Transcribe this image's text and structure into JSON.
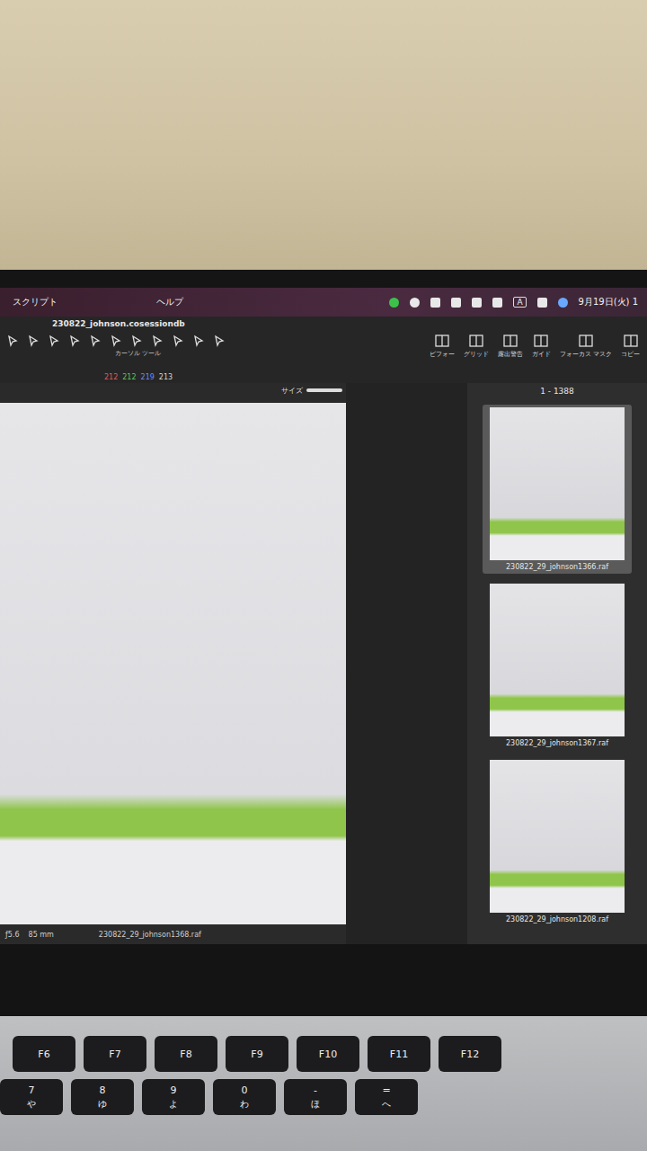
{
  "menubar": {
    "items": [
      {
        "label": "スクリプト"
      },
      {
        "label": "ヘルプ"
      }
    ],
    "input_source": "A",
    "clock": "9月19日(火) 1"
  },
  "document": {
    "title": "230822_johnson.cosessiondb"
  },
  "tools": {
    "label": "カーソル ツール"
  },
  "toolbar_buttons": [
    {
      "label": "ビフォー"
    },
    {
      "label": "グリッド"
    },
    {
      "label": "露出警告"
    },
    {
      "label": "ガイド"
    },
    {
      "label": "フォーカス マスク"
    },
    {
      "label": "コピー"
    }
  ],
  "readout": [
    {
      "value": "212",
      "color": "#e05a5a"
    },
    {
      "value": "212",
      "color": "#5ec45e"
    },
    {
      "value": "219",
      "color": "#6a8cff"
    },
    {
      "value": "213",
      "color": "#d8d8d8"
    }
  ],
  "viewer": {
    "size_label": "サイズ",
    "caption": "230822_29_johnson1368.raf",
    "aperture": "ƒ5.6",
    "focal": "85 mm"
  },
  "browser": {
    "range": "1 - 1388",
    "thumbnails": [
      {
        "filename": "230822_29_johnson1366.raf",
        "selected": true
      },
      {
        "filename": "230822_29_johnson1367.raf",
        "selected": false
      },
      {
        "filename": "230822_29_johnson1208.raf",
        "selected": false
      }
    ]
  },
  "keyboard": {
    "function_keys": [
      {
        "label": "F6"
      },
      {
        "label": "F7"
      },
      {
        "label": "F8"
      },
      {
        "label": "F9"
      },
      {
        "label": "F10"
      },
      {
        "label": "F11"
      },
      {
        "label": "F12"
      }
    ],
    "number_keys": [
      {
        "main": "7",
        "kana": "や"
      },
      {
        "main": "8",
        "kana": "ゆ"
      },
      {
        "main": "9",
        "kana": "よ"
      },
      {
        "main": "0",
        "kana": "わ"
      },
      {
        "main": "-",
        "kana": "ほ"
      },
      {
        "main": "=",
        "kana": "へ"
      }
    ]
  }
}
